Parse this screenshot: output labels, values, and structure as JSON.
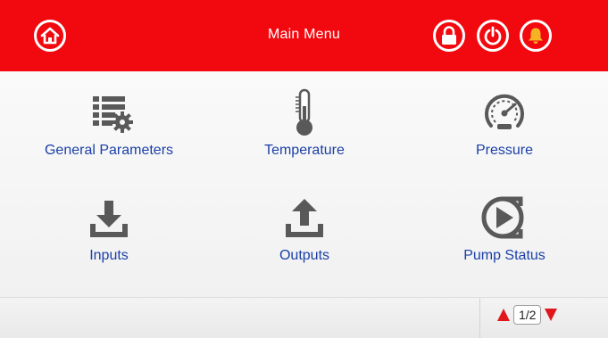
{
  "header": {
    "title": "Main Menu",
    "icons": {
      "home": "home-icon",
      "lock": "lock-icon",
      "power": "power-icon",
      "alarm": "bell-icon"
    },
    "bar_color": "#f2090f"
  },
  "menu": {
    "items": [
      {
        "label": "General Parameters",
        "icon": "settings-list-icon"
      },
      {
        "label": "Temperature",
        "icon": "thermometer-icon"
      },
      {
        "label": "Pressure",
        "icon": "gauge-icon"
      },
      {
        "label": "Inputs",
        "icon": "download-icon"
      },
      {
        "label": "Outputs",
        "icon": "upload-icon"
      },
      {
        "label": "Pump Status",
        "icon": "pump-play-icon"
      }
    ],
    "label_color": "#1b3fa7"
  },
  "footer": {
    "page_indicator": "1/2",
    "arrow_color": "#e0181c"
  }
}
